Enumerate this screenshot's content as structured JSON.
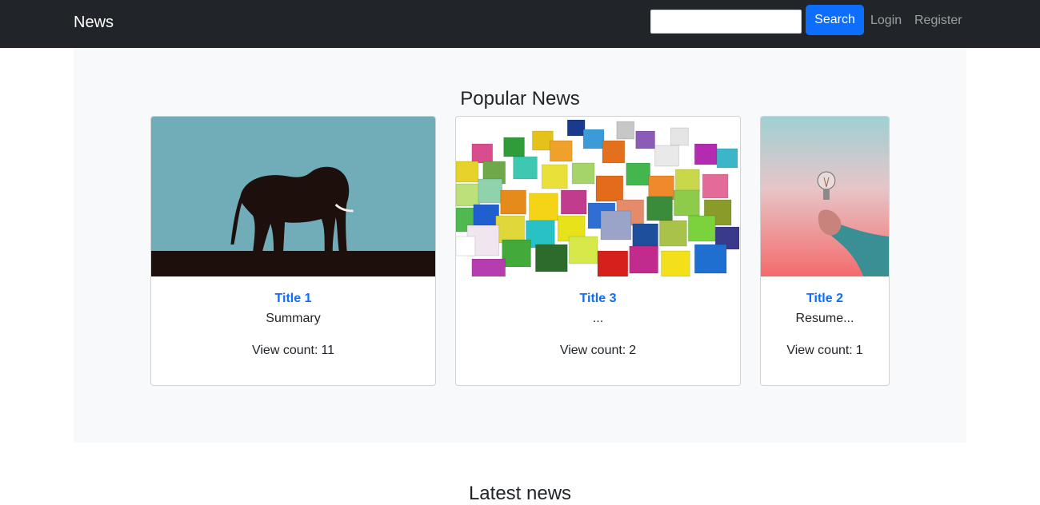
{
  "navbar": {
    "brand": "News",
    "search_placeholder": "",
    "search_button": "Search",
    "login": "Login",
    "register": "Register"
  },
  "popular": {
    "heading": "Popular News",
    "view_count_label": "View count:",
    "cards": [
      {
        "title": "Title 1",
        "summary": "Summary",
        "view_count": "11",
        "image": "elephant-silhouette"
      },
      {
        "title": "Title 3",
        "summary": "...",
        "view_count": "2",
        "image": "colorful-cubes"
      },
      {
        "title": "Title 2",
        "summary": "Resume...",
        "view_count": "1",
        "image": "hand-holding-lightbulb"
      }
    ]
  },
  "latest": {
    "heading": "Latest news"
  },
  "colors": {
    "navbar": "#212529",
    "primary": "#0d6efd",
    "section_bg": "#f8f9fa"
  }
}
